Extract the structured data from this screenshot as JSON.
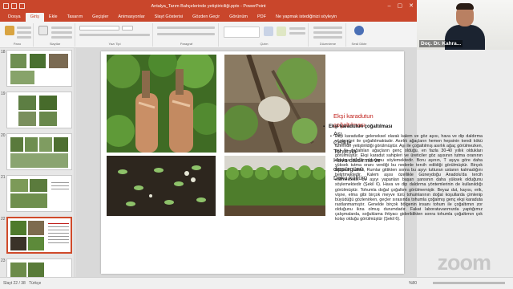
{
  "window": {
    "title": "Antalya_Tarım Bahçelerinde yetiştiriciliği.pptx - PowerPoint",
    "controls": [
      "–",
      "▢",
      "✕"
    ]
  },
  "ribbon": {
    "tabs": [
      "Dosya",
      "Giriş",
      "Ekle",
      "Tasarım",
      "Geçişler",
      "Animasyonlar",
      "Slayt Gösterisi",
      "Gözden Geçir",
      "Görünüm",
      "PDF",
      "Ne yapmak istediğinizi söyleyin"
    ],
    "active_tab": "Giriş",
    "groups": [
      "Pano",
      "Slaytlar",
      "Yazı Tipi",
      "Paragraf",
      "Çizim",
      "Düzenleme",
      "Sesli Dikte"
    ]
  },
  "thumbnails": [
    {
      "number": "18"
    },
    {
      "number": "19"
    },
    {
      "number": "20"
    },
    {
      "number": "21"
    },
    {
      "number": "22"
    },
    {
      "number": "23"
    }
  ],
  "slide": {
    "list_heading": "Ekşi karadutun çoğaltılması",
    "list_items": [
      "Aşı",
      "Çelikle",
      "Tohumla",
      "Hava daldırma ve dipsürgünü",
      "Doku kültürü"
    ],
    "bullet_title": "Ekşi karadutun çoğaltılması",
    "body": "Ekşi karadutlar geleneksel olarak kalem ve göz aşısı, hava ve dip daldırma yöntemleri ile çoğaltılmaktadır. Asırlık ağaçların hemen hepsinin kendi kökü üzerinde yetiştirildiği görülmüştür. Aşı ile çoğaltılmış asırlık ağaç görülmezken, aşı ile çoğaltılan ağaçların genç olduğu, en fazla 30-40 yıllık oldukları görülmüştür. Ekşi karadut sahipleri ve üreticiler göz aşısının tutma oranının oldukça düşük olduğunu söylemektedir. Boru aşının, T aşıya göre daha yüksek tutma oranı verdiği bu nedenle tercih edildiği görülmüştür. Birçok bölgenin sakini, Rumlar gittikten sonra bu aşıyı tutturan ustanın kalmadığını belirtmektedir. Kalem aşısı özellikle Güneydoğu Anadolu'da tercih edilmektedir, bu aşıyı yapanları başarı şansının daha yüksek olduğunu söylemektedir (Şekil 6). Hava ve dip daldırma yöntemlerinin de kullanıldığı görülmüştür. Tohumla doğal çoğaltım görülmemiştir. Beyaz dut, kayısı, erik, vişne, elma gibi birçok meyve türü tohumlarının doğal koşullarda çimlenip büyüdüğü gözlenirken, geçler sırasında tohumla çoğalmış genç ekşi karaduta rastlanmamıştır. Genelde birçok bölgenin insanı tohum ile çoğaltımın zor olduğunu ikna olmuş durumdadır. Fakat laboratuvarımızda yaptığımız çalışmalarda, soğuklama ihtiyacı giderildikten sonra tohumla çoğaltımın çok kolay olduğu görülmüştür (Şekil 6)."
  },
  "status": {
    "slide_info": "Slayt 22 / 38",
    "language": "Türkçe",
    "zoom": "%80"
  },
  "video": {
    "name": "Doç. Dr. Kahra..."
  },
  "watermark": "zoom",
  "colors": {
    "accent": "#c9462b",
    "heading_red": "#c0201b"
  }
}
